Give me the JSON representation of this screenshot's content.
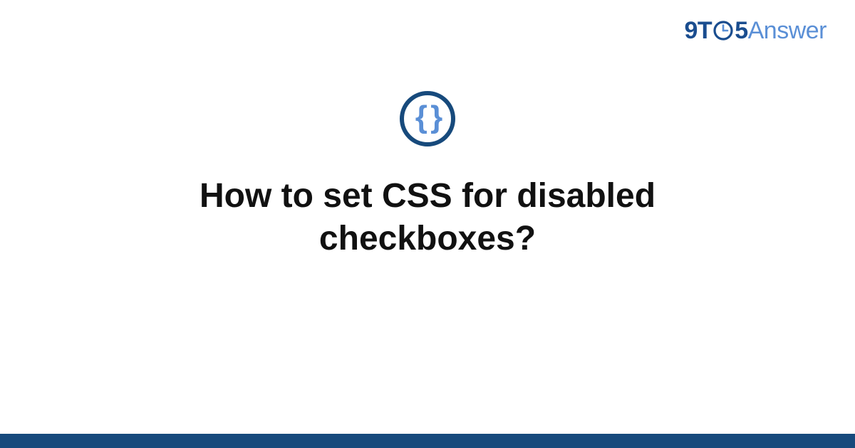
{
  "brand": {
    "part1": "9T",
    "part2": "5",
    "part3": "Answer"
  },
  "icon": {
    "glyph": "{ }",
    "semantic": "code-braces"
  },
  "question": {
    "title": "How to set CSS for disabled checkboxes?"
  },
  "colors": {
    "brand_dark": "#174a7c",
    "brand_light": "#5a8fd6"
  }
}
